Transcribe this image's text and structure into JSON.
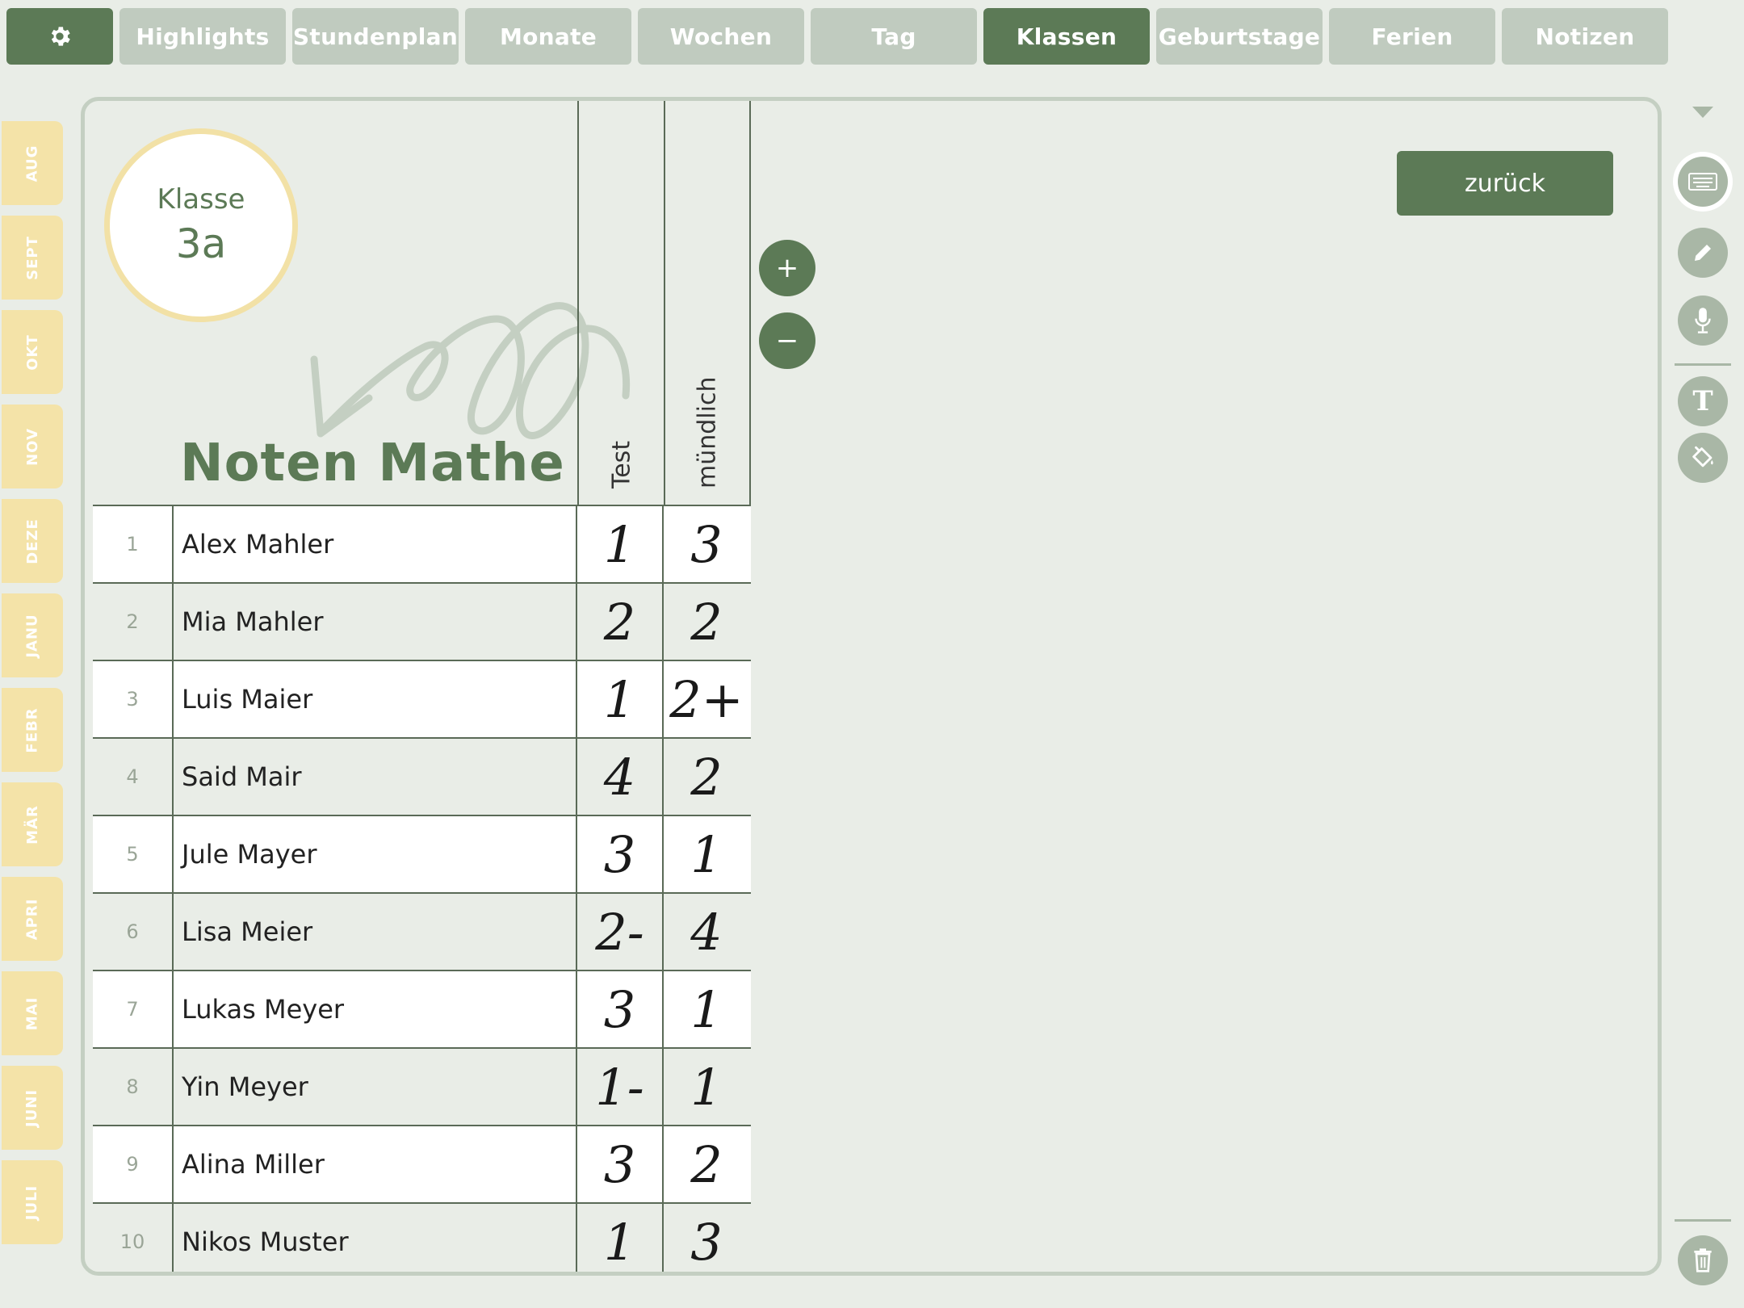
{
  "nav": {
    "tabs": [
      {
        "label": "Highlights"
      },
      {
        "label": "Stundenplan"
      },
      {
        "label": "Monate"
      },
      {
        "label": "Wochen"
      },
      {
        "label": "Tag"
      },
      {
        "label": "Klassen",
        "active": true
      },
      {
        "label": "Geburtstage"
      },
      {
        "label": "Ferien"
      },
      {
        "label": "Notizen"
      }
    ],
    "settings_icon": "gear-icon"
  },
  "months": [
    "AUG",
    "SEPT",
    "OKT",
    "NOV",
    "DEZE",
    "JANU",
    "FEBR",
    "MÄR",
    "APRI",
    "MAI",
    "JUNI",
    "JULI"
  ],
  "class_card": {
    "label": "Klasse",
    "name": "3a"
  },
  "title": "Noten Mathe",
  "columns": [
    "Test",
    "mündlich"
  ],
  "students": [
    {
      "num": "1",
      "name": "Alex Mahler",
      "test": "1",
      "oral": "3"
    },
    {
      "num": "2",
      "name": "Mia Mahler",
      "test": "2",
      "oral": "2"
    },
    {
      "num": "3",
      "name": "Luis Maier",
      "test": "1",
      "oral": "2+"
    },
    {
      "num": "4",
      "name": "Said Mair",
      "test": "4",
      "oral": "2"
    },
    {
      "num": "5",
      "name": "Jule Mayer",
      "test": "3",
      "oral": "1"
    },
    {
      "num": "6",
      "name": "Lisa Meier",
      "test": "2-",
      "oral": "4"
    },
    {
      "num": "7",
      "name": "Lukas Meyer",
      "test": "3",
      "oral": "1"
    },
    {
      "num": "8",
      "name": "Yin Meyer",
      "test": "1-",
      "oral": "1"
    },
    {
      "num": "9",
      "name": "Alina Miller",
      "test": "3",
      "oral": "2"
    },
    {
      "num": "10",
      "name": "Nikos Muster",
      "test": "1",
      "oral": "3"
    }
  ],
  "controls": {
    "add": "+",
    "remove": "−",
    "back": "zurück"
  },
  "toolbar": {
    "tools": [
      "keyboard-icon",
      "pencil-icon",
      "microphone-icon",
      "text-icon",
      "fill-bucket-icon",
      "trash-icon"
    ],
    "text_glyph": "T"
  },
  "colors": {
    "accent": "#5c7a56",
    "tab_inactive": "#c0cbbf",
    "month_tab": "#f4e3a8",
    "background": "#e9ede7"
  }
}
